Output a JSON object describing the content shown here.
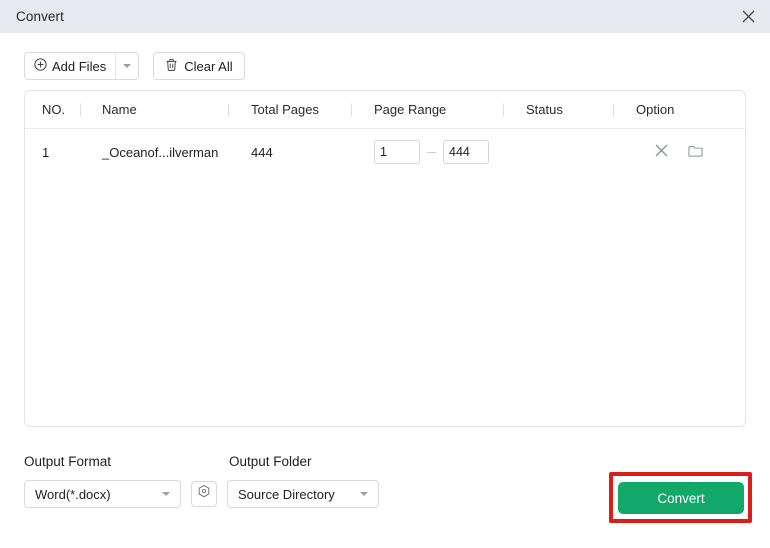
{
  "window": {
    "title": "Convert",
    "close_icon": "close-icon"
  },
  "toolbar": {
    "add_files_label": "Add Files",
    "add_files_icon": "plus-circle-icon",
    "add_files_caret_icon": "chevron-down-icon",
    "clear_all_label": "Clear All",
    "clear_all_icon": "trash-icon"
  },
  "table": {
    "columns": [
      {
        "key": "no",
        "label": "NO."
      },
      {
        "key": "name",
        "label": "Name"
      },
      {
        "key": "total_pages",
        "label": "Total Pages"
      },
      {
        "key": "page_range",
        "label": "Page Range"
      },
      {
        "key": "status",
        "label": "Status"
      },
      {
        "key": "option",
        "label": "Option"
      }
    ],
    "rows": [
      {
        "no": "1",
        "name": "_Oceanof...ilverman",
        "total_pages": "444",
        "range_from": "1",
        "range_to": "444",
        "status": "",
        "remove_icon": "close-icon",
        "folder_icon": "folder-icon"
      }
    ]
  },
  "output": {
    "format_label": "Output Format",
    "format_value": "Word(*.docx)",
    "format_caret_icon": "chevron-down-icon",
    "settings_icon": "gear-hex-icon",
    "folder_label": "Output Folder",
    "folder_value": "Source Directory",
    "folder_caret_icon": "chevron-down-icon"
  },
  "actions": {
    "convert_label": "Convert"
  },
  "colors": {
    "titlebar_bg": "#E6E9F0",
    "accent_green": "#12A86A",
    "annotation_red": "#D81F18",
    "panel_border": "#E2E4E8"
  }
}
